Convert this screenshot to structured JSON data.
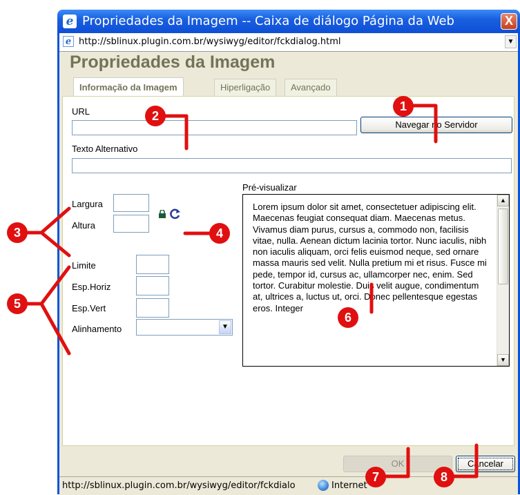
{
  "window": {
    "title": "Propriedades da Imagem -- Caixa de diálogo Página da Web",
    "close_label": "X",
    "address": "http://sblinux.plugin.com.br/wysiwyg/editor/fckdialog.html"
  },
  "dialog": {
    "title": "Propriedades da Imagem",
    "tabs": [
      {
        "label": "Informação da Imagem",
        "active": true
      },
      {
        "label": "Hiperligação",
        "active": false
      },
      {
        "label": "Avançado",
        "active": false
      }
    ],
    "url_label": "URL",
    "url_value": "",
    "browse_button": "Navegar no Servidor",
    "alt_label": "Texto Alternativo",
    "alt_value": "",
    "width_label": "Largura",
    "height_label": "Altura",
    "border_label": "Limite",
    "hspace_label": "Esp.Horiz",
    "vspace_label": "Esp.Vert",
    "align_label": "Alinhamento",
    "align_value": "",
    "preview_label": "Pré-visualizar",
    "preview_text": "Lorem ipsum dolor sit amet, consectetuer adipiscing elit. Maecenas feugiat consequat diam. Maecenas metus. Vivamus diam purus, cursus a, commodo non, facilisis vitae, nulla. Aenean dictum lacinia tortor. Nunc iaculis, nibh non iaculis aliquam, orci felis euismod neque, sed ornare massa mauris sed velit. Nulla pretium mi et risus. Fusce mi pede, tempor id, cursus ac, ullamcorper nec, enim. Sed tortor. Curabitur molestie. Duis velit augue, condimentum at, ultrices a, luctus ut, orci. Donec pellentesque egestas eros. Integer",
    "ok_button": "OK",
    "cancel_button": "Cancelar"
  },
  "statusbar": {
    "url": "http://sblinux.plugin.com.br/wysiwyg/editor/fckdialo",
    "zone": "Internet"
  },
  "callouts": [
    "1",
    "2",
    "3",
    "4",
    "5",
    "6",
    "7",
    "8"
  ],
  "colors": {
    "titlebar": "#0d4fd6",
    "dialog_title": "#737357",
    "callout": "#e01010",
    "face": "#ece9d8"
  },
  "icons": [
    "ie-page-icon",
    "close-icon",
    "lock-icon",
    "reset-size-icon",
    "chevron-down-icon",
    "scroll-up-icon",
    "scroll-down-icon",
    "globe-icon"
  ]
}
